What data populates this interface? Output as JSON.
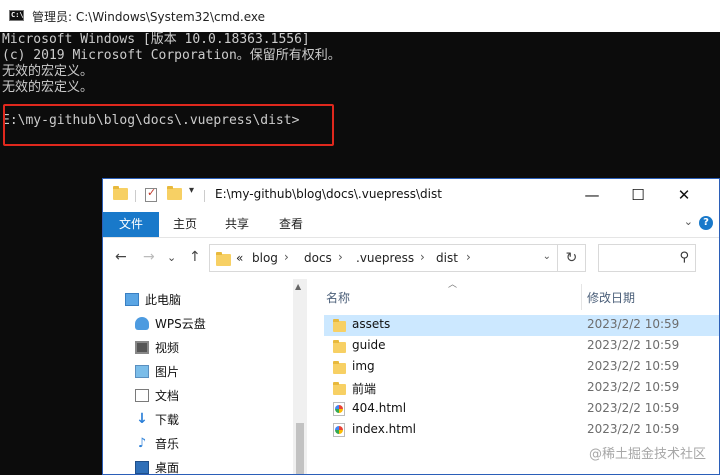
{
  "cmd": {
    "title": "管理员: C:\\Windows\\System32\\cmd.exe",
    "icon_text": "C:\\",
    "lines": [
      "Microsoft Windows [版本 10.0.18363.1556]",
      "(c) 2019 Microsoft Corporation。保留所有权利。",
      "无效的宏定义。",
      "无效的宏定义。",
      "",
      "E:\\my-github\\blog\\docs\\.vuepress\\dist>"
    ]
  },
  "explorer": {
    "title": "E:\\my-github\\blog\\docs\\.vuepress\\dist",
    "window_buttons": {
      "minimize": "—",
      "maximize": "☐",
      "close": "✕"
    },
    "ribbon": {
      "tabs": [
        "文件",
        "主页",
        "共享",
        "查看"
      ],
      "expand": "⌄",
      "help": "?"
    },
    "nav": {
      "back": "←",
      "forward": "→",
      "recent": "⌄",
      "up": "↑",
      "refresh": "↻",
      "search_icon": "⚲"
    },
    "address": {
      "overflow": "«",
      "crumbs": [
        "blog",
        "docs",
        ".vuepress",
        "dist"
      ],
      "separator": "›",
      "drop": "⌄"
    },
    "sidebar": {
      "items": [
        {
          "label": "此电脑",
          "icon": "pc-icon"
        },
        {
          "label": "WPS云盘",
          "icon": "cloud-icon"
        },
        {
          "label": "视频",
          "icon": "video-icon"
        },
        {
          "label": "图片",
          "icon": "picture-icon"
        },
        {
          "label": "文档",
          "icon": "document-icon"
        },
        {
          "label": "下载",
          "icon": "download-icon"
        },
        {
          "label": "音乐",
          "icon": "music-icon"
        },
        {
          "label": "桌面",
          "icon": "desktop-icon"
        }
      ]
    },
    "columns": {
      "name": "名称",
      "modified": "修改日期"
    },
    "files": [
      {
        "name": "assets",
        "type": "folder",
        "date": "2023/2/2 10:59"
      },
      {
        "name": "guide",
        "type": "folder",
        "date": "2023/2/2 10:59"
      },
      {
        "name": "img",
        "type": "folder",
        "date": "2023/2/2 10:59"
      },
      {
        "name": "前端",
        "type": "folder",
        "date": "2023/2/2 10:59"
      },
      {
        "name": "404.html",
        "type": "html",
        "date": "2023/2/2 10:59"
      },
      {
        "name": "index.html",
        "type": "html",
        "date": "2023/2/2 10:59"
      }
    ]
  },
  "watermark": "@稀土掘金技术社区"
}
